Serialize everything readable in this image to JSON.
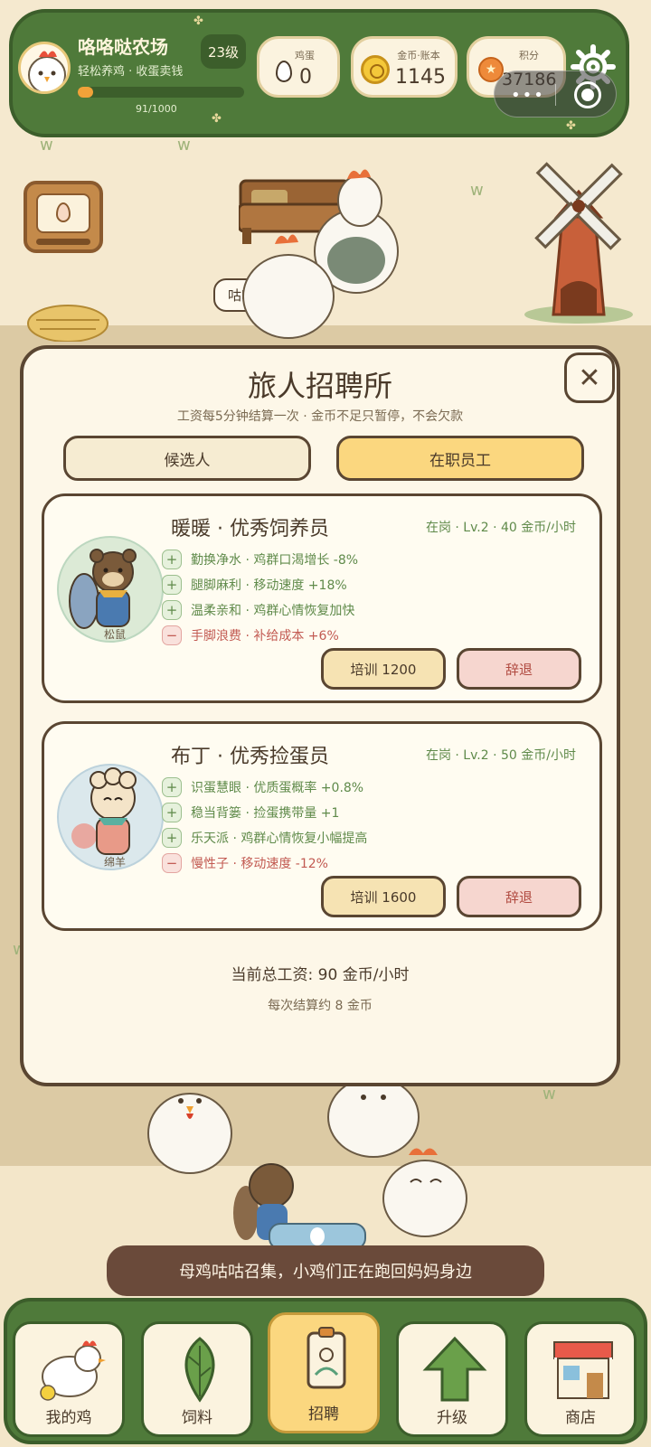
{
  "header": {
    "farm_name": "咯咯哒农场",
    "farm_subtitle": "轻松养鸡 · 收蛋卖钱",
    "level": "23级",
    "xp_text": "91/1000",
    "xp_progress": 0.091
  },
  "stats": {
    "eggs_label": "鸡蛋",
    "eggs_value": "0",
    "coins_label": "金币·账本",
    "coins_value": "1145",
    "points_label": "积分",
    "points_value": "37186"
  },
  "scene": {
    "speech_bubble": "咕咕!"
  },
  "modal": {
    "title": "旅人招聘所",
    "subtitle": "工资每5分钟结算一次 · 金币不足只暂停，不会欠款",
    "tabs": [
      "候选人",
      "在职员工"
    ],
    "active_tab": "在职员工",
    "workers": [
      {
        "name": "暖暖 · 优秀饲养员",
        "status": "在岗 · Lv.2 · 40 金币/小时",
        "species": "松鼠",
        "traits": [
          {
            "sign": "+",
            "text": "勤换净水 · 鸡群口渴增长 -8%"
          },
          {
            "sign": "+",
            "text": "腿脚麻利 · 移动速度 +18%"
          },
          {
            "sign": "+",
            "text": "温柔亲和 · 鸡群心情恢复加快"
          },
          {
            "sign": "−",
            "text": "手脚浪费 · 补给成本 +6%"
          }
        ],
        "train_label": "培训 1200",
        "fire_label": "辞退"
      },
      {
        "name": "布丁 · 优秀捡蛋员",
        "status": "在岗 · Lv.2 · 50 金币/小时",
        "species": "绵羊",
        "traits": [
          {
            "sign": "+",
            "text": "识蛋慧眼 · 优质蛋概率 +0.8%"
          },
          {
            "sign": "+",
            "text": "稳当背篓 · 捡蛋携带量 +1"
          },
          {
            "sign": "+",
            "text": "乐天派 · 鸡群心情恢复小幅提高"
          },
          {
            "sign": "−",
            "text": "慢性子 · 移动速度 -12%"
          }
        ],
        "train_label": "培训 1600",
        "fire_label": "辞退"
      }
    ],
    "total_wage": "当前总工资: 90 金币/小时",
    "per_settlement": "每次结算约 8 金币"
  },
  "toast": "母鸡咕咕召集，小鸡们正在跑回妈妈身边",
  "nav": {
    "items": [
      "我的鸡",
      "饲料",
      "招聘",
      "升级",
      "商店"
    ],
    "active": "招聘"
  },
  "colors": {
    "bar_green": "#4f7a3a",
    "modal_bg": "#fdf7e8",
    "active_tab": "#fbd77f",
    "positive": "#5f8a4a",
    "negative": "#c25a52"
  }
}
